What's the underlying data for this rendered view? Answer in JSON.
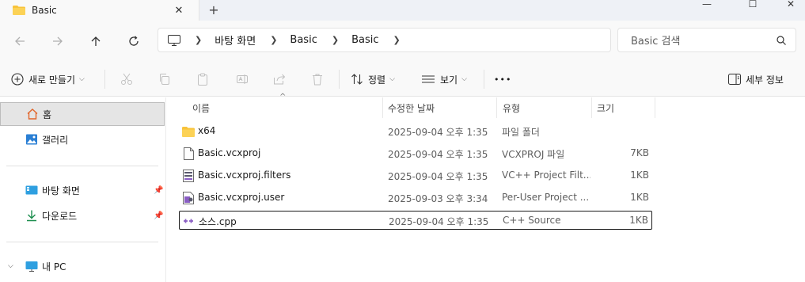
{
  "tab": {
    "title": "Basic",
    "close": "✕",
    "new_tab": "+"
  },
  "window_controls": {
    "minimize": "—",
    "maximize": "☐",
    "close": "✕"
  },
  "address": {
    "crumbs": [
      "바탕 화면",
      "Basic",
      "Basic"
    ]
  },
  "search": {
    "placeholder": "Basic 검색"
  },
  "command_bar": {
    "new_label": "새로 만들기",
    "sort_label": "정렬",
    "view_label": "보기",
    "more": "•••",
    "details_label": "세부 정보"
  },
  "sidebar": {
    "home": "홈",
    "gallery": "갤러리",
    "desktop": "바탕 화면",
    "downloads": "다운로드",
    "this_pc": "내 PC"
  },
  "columns": {
    "name": "이름",
    "modified": "수정한 날짜",
    "type": "유형",
    "size": "크기"
  },
  "files": [
    {
      "name": "x64",
      "modified": "2025-09-04 오후 1:35",
      "type": "파일 폴더",
      "size": "",
      "icon": "folder-icon"
    },
    {
      "name": "Basic.vcxproj",
      "modified": "2025-09-04 오후 1:35",
      "type": "VCXPROJ 파일",
      "size": "7KB",
      "icon": "file-icon"
    },
    {
      "name": "Basic.vcxproj.filters",
      "modified": "2025-09-04 오후 1:35",
      "type": "VC++ Project Filt...",
      "size": "1KB",
      "icon": "filters-file-icon"
    },
    {
      "name": "Basic.vcxproj.user",
      "modified": "2025-09-03 오후 3:34",
      "type": "Per-User Project ...",
      "size": "1KB",
      "icon": "user-file-icon"
    },
    {
      "name": "소스.cpp",
      "modified": "2025-09-04 오후 1:35",
      "type": "C++ Source",
      "size": "1KB",
      "icon": "cpp-file-icon"
    }
  ],
  "colors": {
    "folder": "#f8c33a",
    "accent": "#0067c0",
    "cpp": "#8a5ec4"
  }
}
